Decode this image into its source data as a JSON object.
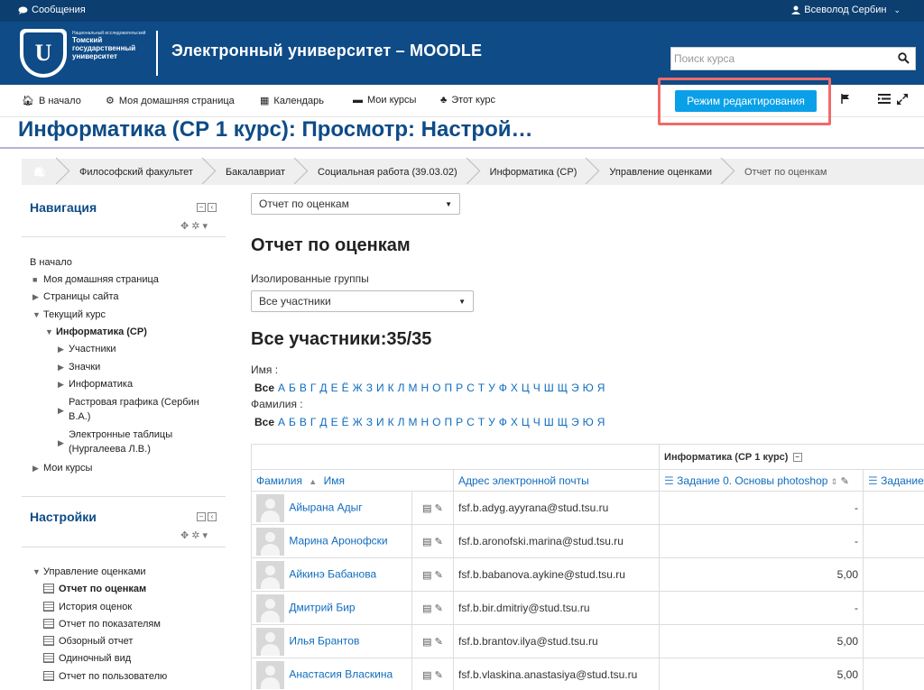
{
  "topbar": {
    "messages": "Сообщения",
    "user": "Всеволод Сербин"
  },
  "header": {
    "logo_small": "Национальный исследовательский",
    "logo_name": "Томский государственный университет",
    "logo_letter": "U",
    "site_title": "Электронный университет – MOODLE",
    "search_placeholder": "Поиск курса"
  },
  "navbar": {
    "items": [
      "В начало",
      "Моя домашняя страница",
      "Календарь",
      "Мои курсы",
      "Этот курс"
    ],
    "edit_button": "Режим редактирования"
  },
  "page_title": "Информатика (СР 1 курс): Просмотр: Настрой…",
  "breadcrumb": [
    "Философский факультет",
    "Бакалавриат",
    "Социальная работа (39.03.02)",
    "Информатика (СР)",
    "Управление оценками",
    "Отчет по оценкам"
  ],
  "navigation": {
    "title": "Навигация",
    "items": [
      "В начало",
      "Моя домашняя страница",
      "Страницы сайта",
      "Текущий курс",
      "Информатика (СР)",
      "Участники",
      "Значки",
      "Информатика",
      "Растровая графика (Сербин В.А.)",
      "Электронные таблицы (Нургалеева Л.В.)",
      "Мои курсы"
    ]
  },
  "settings": {
    "title": "Настройки",
    "items": [
      "Управление оценками",
      "Отчет по оценкам",
      "История оценок",
      "Отчет по показателям",
      "Обзорный отчет",
      "Одиночный вид",
      "Отчет по пользователю"
    ]
  },
  "main": {
    "report_select": "Отчет по оценкам",
    "heading": "Отчет по оценкам",
    "groups_label": "Изолированные группы",
    "groups_select": "Все участники",
    "participants": "Все участники:35/35",
    "first_name_label": "Имя :",
    "last_name_label": "Фамилия :",
    "all_label": "Все",
    "letters": [
      "А",
      "Б",
      "В",
      "Г",
      "Д",
      "Е",
      "Ё",
      "Ж",
      "З",
      "И",
      "К",
      "Л",
      "М",
      "Н",
      "О",
      "П",
      "Р",
      "С",
      "Т",
      "У",
      "Ф",
      "Х",
      "Ц",
      "Ч",
      "Ш",
      "Щ",
      "Э",
      "Ю",
      "Я"
    ]
  },
  "table": {
    "course_header": "Информатика (СР 1 курс)",
    "col_lastname": "Фамилия",
    "col_firstname": "Имя",
    "col_email": "Адрес электронной почты",
    "col_task0": "Задание 0. Основы photoshop",
    "col_task_next": "Задание",
    "rows": [
      {
        "name": "Айырана Адыг",
        "email": "fsf.b.adyg.ayyrana@stud.tsu.ru",
        "grade": "-"
      },
      {
        "name": "Марина Аронофски",
        "email": "fsf.b.aronofski.marina@stud.tsu.ru",
        "grade": "-"
      },
      {
        "name": "Айкинэ Бабанова",
        "email": "fsf.b.babanova.aykine@stud.tsu.ru",
        "grade": "5,00"
      },
      {
        "name": "Дмитрий Бир",
        "email": "fsf.b.bir.dmitriy@stud.tsu.ru",
        "grade": "-"
      },
      {
        "name": "Илья Брантов",
        "email": "fsf.b.brantov.ilya@stud.tsu.ru",
        "grade": "5,00"
      },
      {
        "name": "Анастасия Власкина",
        "email": "fsf.b.vlaskina.anastasiya@stud.tsu.ru",
        "grade": "5,00"
      }
    ]
  },
  "colors": {
    "brand": "#0e4b87",
    "topbar": "#0c3e6f",
    "button": "#0aa0e8",
    "link": "#0f6cbf",
    "highlight": "#f06a6a"
  }
}
